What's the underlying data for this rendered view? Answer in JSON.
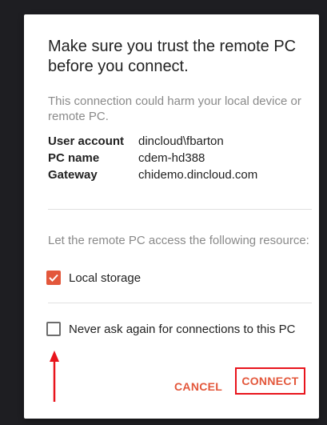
{
  "dialog": {
    "title": "Make sure you trust the remote PC before you connect.",
    "description": "This connection could harm your local device or remote PC.",
    "info": [
      {
        "key": "User account",
        "value": "dincloud\\fbarton"
      },
      {
        "key": "PC name",
        "value": "cdem-hd388"
      },
      {
        "key": "Gateway",
        "value": "chidemo.dincloud.com"
      }
    ],
    "resource_label": "Let the remote PC access the following resource:",
    "local_storage": {
      "label": "Local storage",
      "checked": true
    },
    "never_ask": {
      "label": "Never ask again for connections to this PC",
      "checked": false
    },
    "buttons": {
      "cancel": "CANCEL",
      "connect": "CONNECT"
    }
  },
  "colors": {
    "accent": "#e3573b",
    "highlight": "#e8141c",
    "background": "#1e1e22"
  }
}
